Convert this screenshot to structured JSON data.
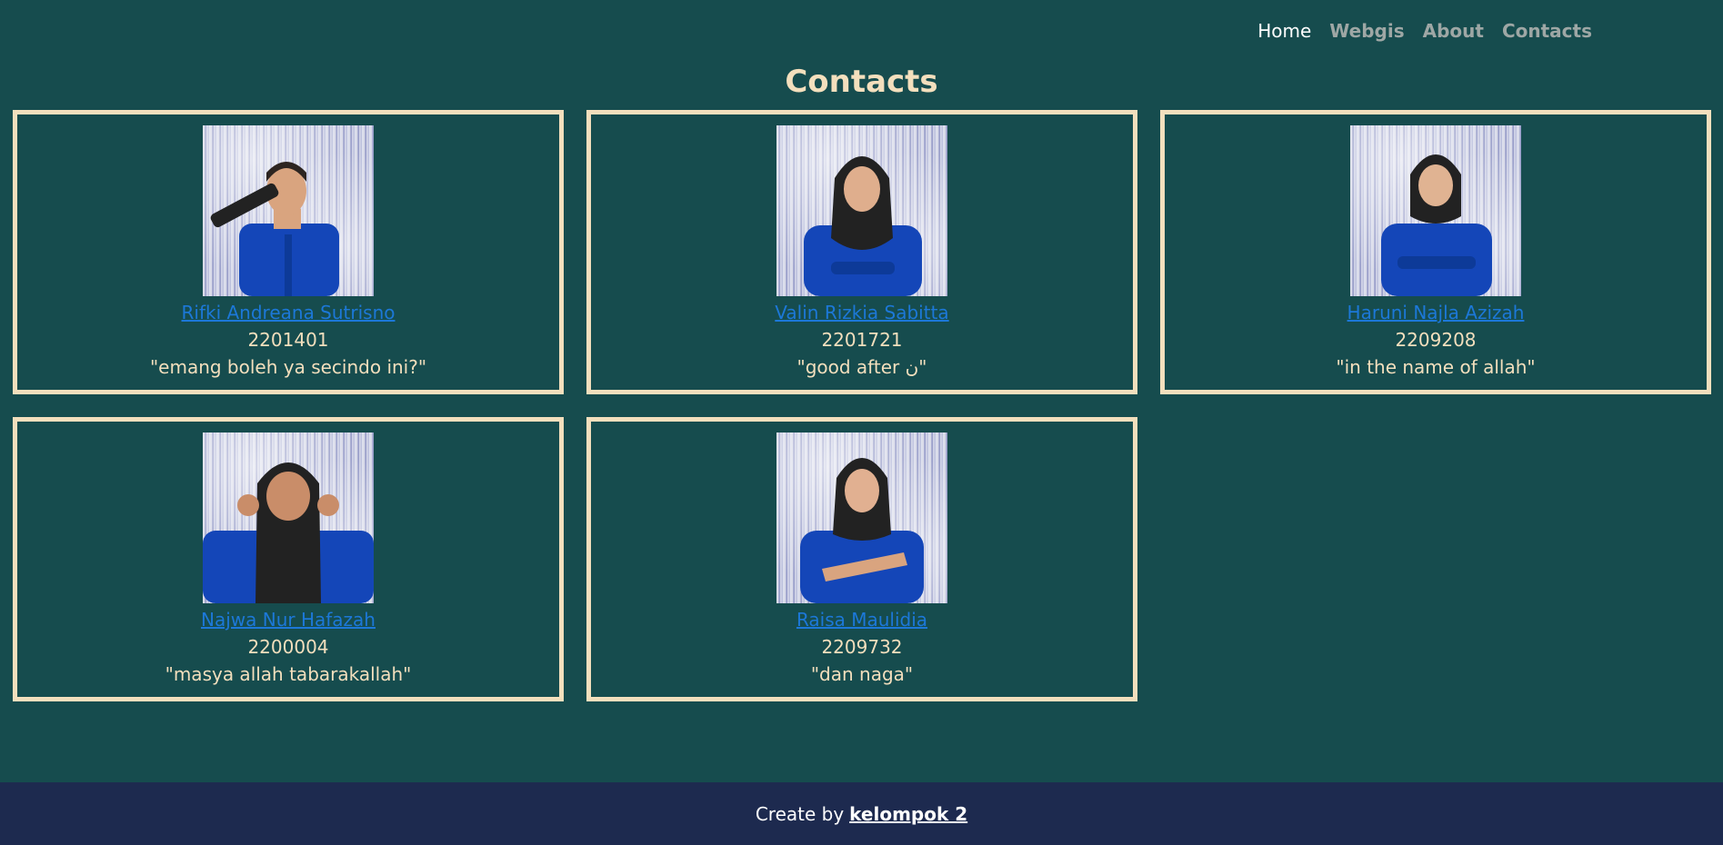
{
  "nav": {
    "items": [
      {
        "label": "Home",
        "active": true
      },
      {
        "label": "Webgis",
        "active": false
      },
      {
        "label": "About",
        "active": false
      },
      {
        "label": "Contacts",
        "active": false
      }
    ]
  },
  "page": {
    "title": "Contacts"
  },
  "contacts": [
    {
      "name": "Rifki Andreana Sutrisno",
      "nim": "2201401",
      "quote": "\"emang boleh ya secindo ini?\""
    },
    {
      "name": "Valin Rizkia Sabitta",
      "nim": "2201721",
      "quote": "\"good after ن\""
    },
    {
      "name": "Haruni Najla Azizah",
      "nim": "2209208",
      "quote": "\"in the name of allah\""
    },
    {
      "name": "Najwa Nur Hafazah",
      "nim": "2200004",
      "quote": "\"masya allah tabarakallah\""
    },
    {
      "name": "Raisa Maulidia",
      "nim": "2209732",
      "quote": "\"dan naga\""
    }
  ],
  "footer": {
    "prefix": "Create by",
    "link": "kelompok 2"
  },
  "colors": {
    "background": "#164c4e",
    "accent": "#f3dfbd",
    "link": "#1c78d8",
    "footer": "#1d2a4f"
  }
}
